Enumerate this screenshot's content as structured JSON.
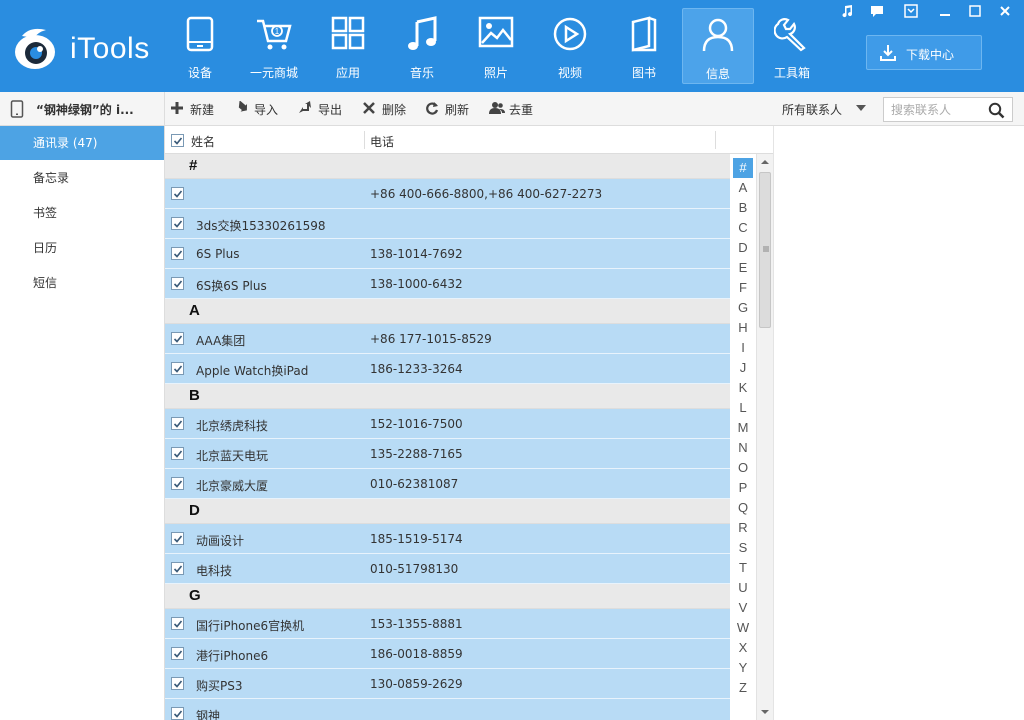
{
  "app": {
    "logo_text": "iTools"
  },
  "nav": [
    {
      "key": "device",
      "label": "设备",
      "icon": "phone-icon"
    },
    {
      "key": "shop",
      "label": "一元商城",
      "icon": "cart-icon"
    },
    {
      "key": "apps",
      "label": "应用",
      "icon": "apps-grid-icon"
    },
    {
      "key": "music",
      "label": "音乐",
      "icon": "music-note-icon"
    },
    {
      "key": "photos",
      "label": "照片",
      "icon": "photo-icon"
    },
    {
      "key": "video",
      "label": "视频",
      "icon": "play-circle-icon"
    },
    {
      "key": "books",
      "label": "图书",
      "icon": "book-icon"
    },
    {
      "key": "info",
      "label": "信息",
      "icon": "user-icon",
      "active": true
    },
    {
      "key": "tools",
      "label": "工具箱",
      "icon": "wrench-icon"
    }
  ],
  "download": {
    "label": "下载中心"
  },
  "toolbar": {
    "device_title": "“钢神绿钢”的 i...",
    "new_label": "新建",
    "import_label": "导入",
    "export_label": "导出",
    "delete_label": "删除",
    "refresh_label": "刷新",
    "dedupe_label": "去重",
    "filter_value": "所有联系人",
    "search_placeholder": "搜索联系人"
  },
  "sidebar": {
    "items": [
      {
        "label": "通讯录 (47)",
        "active": true
      },
      {
        "label": "备忘录"
      },
      {
        "label": "书签"
      },
      {
        "label": "日历"
      },
      {
        "label": "短信"
      }
    ]
  },
  "list": {
    "header_name": "姓名",
    "header_phone": "电话",
    "groups": [
      {
        "letter": "#",
        "contacts": [
          {
            "name": "",
            "phone": "+86 400-666-8800,+86 400-627-2273"
          },
          {
            "name": "3ds交换15330261598",
            "phone": ""
          },
          {
            "name": "6S Plus",
            "phone": "138-1014-7692"
          },
          {
            "name": "6S换6S Plus",
            "phone": "138-1000-6432"
          }
        ]
      },
      {
        "letter": "A",
        "contacts": [
          {
            "name": "AAA集团",
            "phone": "+86 177-1015-8529"
          },
          {
            "name": "Apple Watch换iPad",
            "phone": "186-1233-3264"
          }
        ]
      },
      {
        "letter": "B",
        "contacts": [
          {
            "name": "北京绣虎科技",
            "phone": "152-1016-7500"
          },
          {
            "name": "北京蓝天电玩",
            "phone": "135-2288-7165"
          },
          {
            "name": "北京豪威大厦",
            "phone": "010-62381087"
          }
        ]
      },
      {
        "letter": "D",
        "contacts": [
          {
            "name": "动画设计",
            "phone": "185-1519-5174"
          },
          {
            "name": "电科技",
            "phone": "010-51798130"
          }
        ]
      },
      {
        "letter": "G",
        "contacts": [
          {
            "name": "国行iPhone6官换机",
            "phone": "153-1355-8881"
          },
          {
            "name": "港行iPhone6",
            "phone": "186-0018-8859"
          },
          {
            "name": "购买PS3",
            "phone": "130-0859-2629"
          },
          {
            "name": "钢神",
            "phone": ""
          }
        ]
      }
    ]
  },
  "alphabet": [
    "#",
    "A",
    "B",
    "C",
    "D",
    "E",
    "F",
    "G",
    "H",
    "I",
    "J",
    "K",
    "L",
    "M",
    "N",
    "O",
    "P",
    "Q",
    "R",
    "S",
    "T",
    "U",
    "V",
    "W",
    "X",
    "Y",
    "Z"
  ],
  "colors": {
    "topbar": "#2a8de0",
    "accent": "#4da3e4",
    "row_bg": "#b8dbf5",
    "group_bg": "#e9e9e9"
  }
}
